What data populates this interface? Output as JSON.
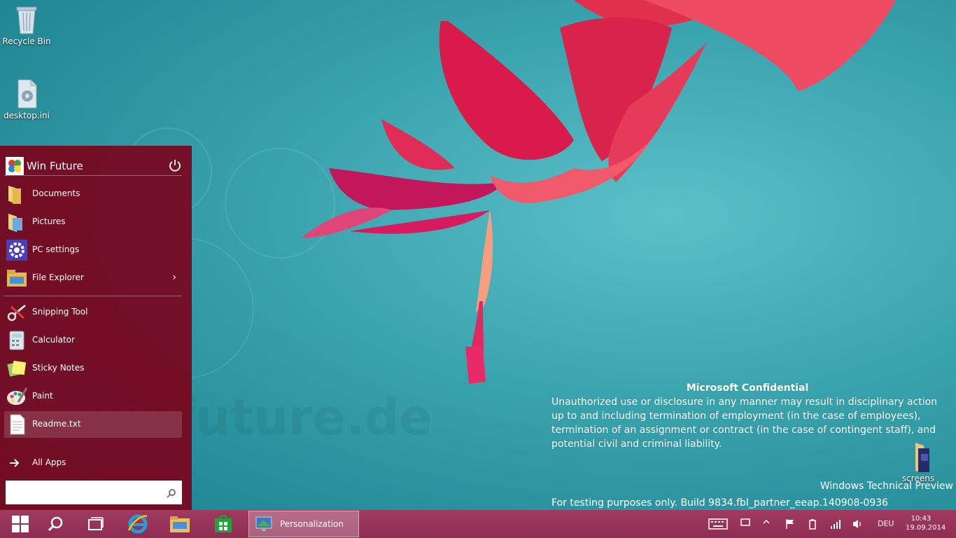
{
  "desktop": {
    "icons": [
      {
        "label": "Recycle Bin"
      },
      {
        "label": "desktop.ini"
      },
      {
        "label": "screens"
      }
    ]
  },
  "start_menu": {
    "user_name": "Win Future",
    "places": [
      {
        "label": "Documents",
        "icon": "documents-folder-icon"
      },
      {
        "label": "Pictures",
        "icon": "pictures-folder-icon"
      },
      {
        "label": "PC settings",
        "icon": "gear-icon"
      },
      {
        "label": "File Explorer",
        "icon": "file-explorer-icon"
      }
    ],
    "apps": [
      {
        "label": "Snipping Tool",
        "icon": "scissors-icon"
      },
      {
        "label": "Calculator",
        "icon": "calculator-icon"
      },
      {
        "label": "Sticky Notes",
        "icon": "sticky-notes-icon"
      },
      {
        "label": "Paint",
        "icon": "paint-palette-icon"
      },
      {
        "label": "Readme.txt",
        "icon": "text-file-icon"
      }
    ],
    "all_apps_label": "All Apps",
    "search_value": ""
  },
  "watermark": {
    "title": "Microsoft Confidential",
    "body": "Unauthorized use or disclosure in any manner may result in disciplinary action up to and including termination of employment (in the case of employees), termination of an assignment or contract (in the case of contingent staff), and potential civil and criminal liability.",
    "product": "Windows Technical Preview",
    "build": "For testing purposes only. Build 9834.fbl_partner_eeap.140908-0936"
  },
  "taskbar": {
    "open_app": "Personalization",
    "language": "DEU",
    "time": "10:43",
    "date": "19.09.2014"
  },
  "colors": {
    "start_menu_bg": "#78041c",
    "taskbar_bg": "#a03a5e",
    "desktop_bg": "#3fa3ad"
  }
}
